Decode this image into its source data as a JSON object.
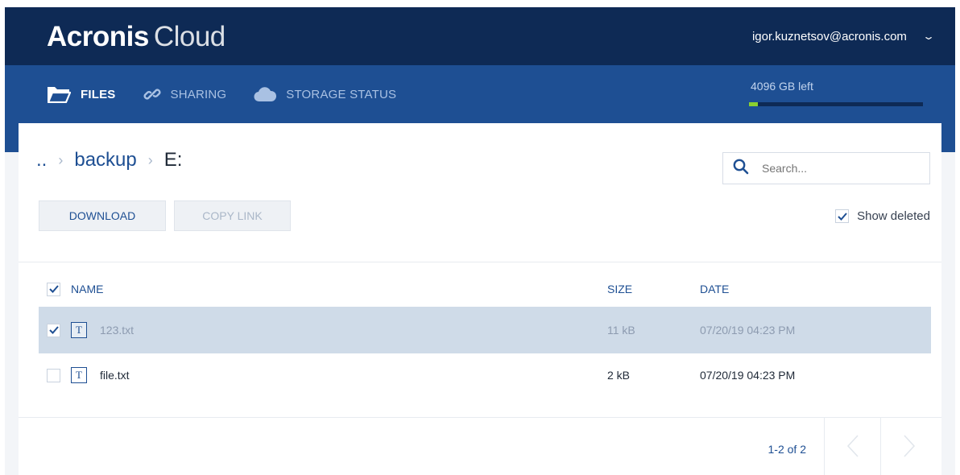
{
  "header": {
    "logo_brand": "Acronis",
    "logo_product": "Cloud",
    "user_email": "igor.kuznetsov@acronis.com",
    "user_menu_icon": "chevron-down-icon"
  },
  "nav": {
    "items": [
      {
        "label": "FILES",
        "icon": "folder-icon",
        "active": true
      },
      {
        "label": "SHARING",
        "icon": "link-icon",
        "active": false
      },
      {
        "label": "STORAGE STATUS",
        "icon": "cloud-icon",
        "active": false
      }
    ],
    "storage": {
      "text": "4096 GB left",
      "used_fraction": 0.05,
      "fill_color": "#8bd02f"
    }
  },
  "breadcrumb": {
    "root": "..",
    "folder": "backup",
    "current": "E:"
  },
  "search": {
    "placeholder": "Search..."
  },
  "toolbar": {
    "download_label": "DOWNLOAD",
    "copy_link_label": "COPY LINK",
    "show_deleted_label": "Show deleted",
    "show_deleted_checked": true
  },
  "table": {
    "headers": {
      "name": "NAME",
      "size": "SIZE",
      "date": "DATE"
    },
    "rows": [
      {
        "name": "123.txt",
        "size": "11 kB",
        "date": "07/20/19 04:23 PM",
        "selected": true,
        "icon": "text-file-icon",
        "icon_glyph": "T"
      },
      {
        "name": "file.txt",
        "size": "2 kB",
        "date": "07/20/19 04:23 PM",
        "selected": false,
        "icon": "text-file-icon",
        "icon_glyph": "T"
      }
    ]
  },
  "pagination": {
    "text": "1-2 of 2"
  },
  "colors": {
    "header_bg": "#0e2a55",
    "nav_bg": "#1e4f93",
    "accent": "#1e4f93",
    "selected_row": "#cfdbe8"
  }
}
